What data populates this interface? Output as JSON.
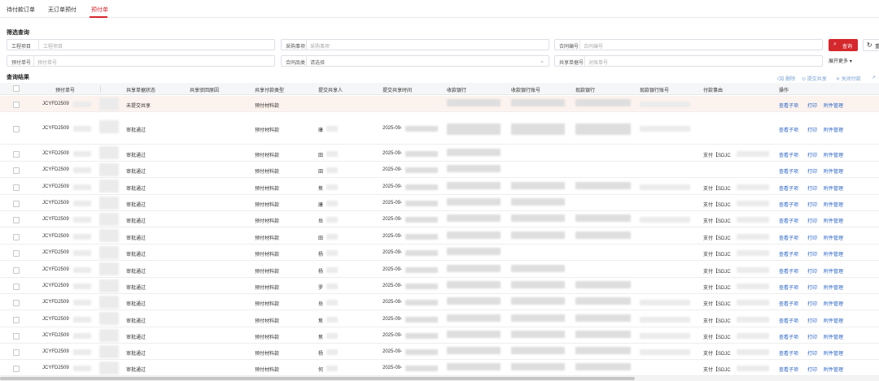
{
  "tabs": [
    "待付款订单",
    "无订单预付",
    "预付单"
  ],
  "filter": {
    "title": "筛选查询",
    "fields": [
      {
        "label": "工程项目",
        "placeholder": "工程项目"
      },
      {
        "label": "采购事项",
        "placeholder": "采购事项"
      },
      {
        "label": "合同编号",
        "placeholder": "合同编号"
      },
      {
        "label": "预付单号",
        "placeholder": "预付单号"
      },
      {
        "label": "合同品类",
        "placeholder": "请选择"
      },
      {
        "label": "共享单据号",
        "placeholder": "对账单号"
      }
    ],
    "query_label": "查询",
    "reset_label": "重",
    "expand_label": "展开更多"
  },
  "results": {
    "title": "查询结果",
    "toolbar": [
      "删除",
      "提交共享",
      "关闭付款"
    ],
    "columns": [
      "预付单号",
      "共享单据状态",
      "共享驳回原因",
      "共享付款类型",
      "提交共享人",
      "提交共享时间",
      "收款银行",
      "收款银行账号",
      "现款银行",
      "现款银行账号",
      "付款事由",
      "操作"
    ],
    "actions": [
      "查看子项",
      "打印",
      "附件管理"
    ],
    "rows": [
      {
        "no": "JCYFD2509",
        "status": "未提交共享",
        "type": "预付材料款",
        "person": "",
        "time": "",
        "reason": ""
      },
      {
        "no": "JCYFD2509",
        "status": "审批通过",
        "type": "预付材料款",
        "person": "康",
        "time": "2025-09-",
        "reason": ""
      },
      {
        "no": "JCYFD2509",
        "status": "审批通过",
        "type": "预付材料款",
        "person": "田",
        "time": "2025-09-",
        "reason": "支付【SDJC"
      },
      {
        "no": "JCYFD2509",
        "status": "审批通过",
        "type": "预付材料款",
        "person": "田",
        "time": "2025-09-",
        "reason": ""
      },
      {
        "no": "JCYFD2509",
        "status": "审批通过",
        "type": "预付材料款",
        "person": "焦",
        "time": "2025-09-",
        "reason": "支付【SDJC"
      },
      {
        "no": "JCYFD2509",
        "status": "审批通过",
        "type": "预付材料款",
        "person": "康",
        "time": "2025-09-",
        "reason": "支付【SDJC"
      },
      {
        "no": "JCYFD2509",
        "status": "审批通过",
        "type": "预付材料款",
        "person": "岳",
        "time": "2025-09-",
        "reason": "支付【SDJC"
      },
      {
        "no": "JCYFD2509",
        "status": "审批通过",
        "type": "预付材料款",
        "person": "田",
        "time": "2025-09-",
        "reason": "支付【SDJC"
      },
      {
        "no": "JCYFD2509",
        "status": "审批通过",
        "type": "预付材料款",
        "person": "杨",
        "time": "2025-09-",
        "reason": "支付【SDJC"
      },
      {
        "no": "JCYFD2509",
        "status": "审批通过",
        "type": "预付材料款",
        "person": "杨",
        "time": "2025-09-",
        "reason": "支付【SDJC"
      },
      {
        "no": "JCYFD2509",
        "status": "审批通过",
        "type": "预付材料款",
        "person": "罗",
        "time": "2025-09-",
        "reason": "支付【SDJC"
      },
      {
        "no": "JCYFD2509",
        "status": "审批通过",
        "type": "预付材料款",
        "person": "岳",
        "time": "2025-09-",
        "reason": "支付【SDJC"
      },
      {
        "no": "JCYFD2509",
        "status": "审批通过",
        "type": "预付材料款",
        "person": "焦",
        "time": "2025-09-",
        "reason": "支付【SDJC"
      },
      {
        "no": "JCYFD2509",
        "status": "审批通过",
        "type": "预付材料款",
        "person": "焦",
        "time": "2025-09-",
        "reason": "支付【SDJC"
      },
      {
        "no": "JCYFD2509",
        "status": "审批通过",
        "type": "预付材料款",
        "person": "杨",
        "time": "2025-09-",
        "reason": "支付【SDJC"
      },
      {
        "no": "JCYFD2509",
        "status": "审批通过",
        "type": "预付材料款",
        "person": "何",
        "time": "2025-09-",
        "reason": "支付【SDJC"
      }
    ]
  },
  "icons": {
    "query": "search-icon",
    "reset": "refresh-icon",
    "delete": "trash-icon",
    "submit": "submit-icon",
    "close": "close-icon"
  },
  "colors": {
    "accent": "#d4282d",
    "link": "#2a64c5",
    "highlight_row": "#fdf3ee"
  }
}
